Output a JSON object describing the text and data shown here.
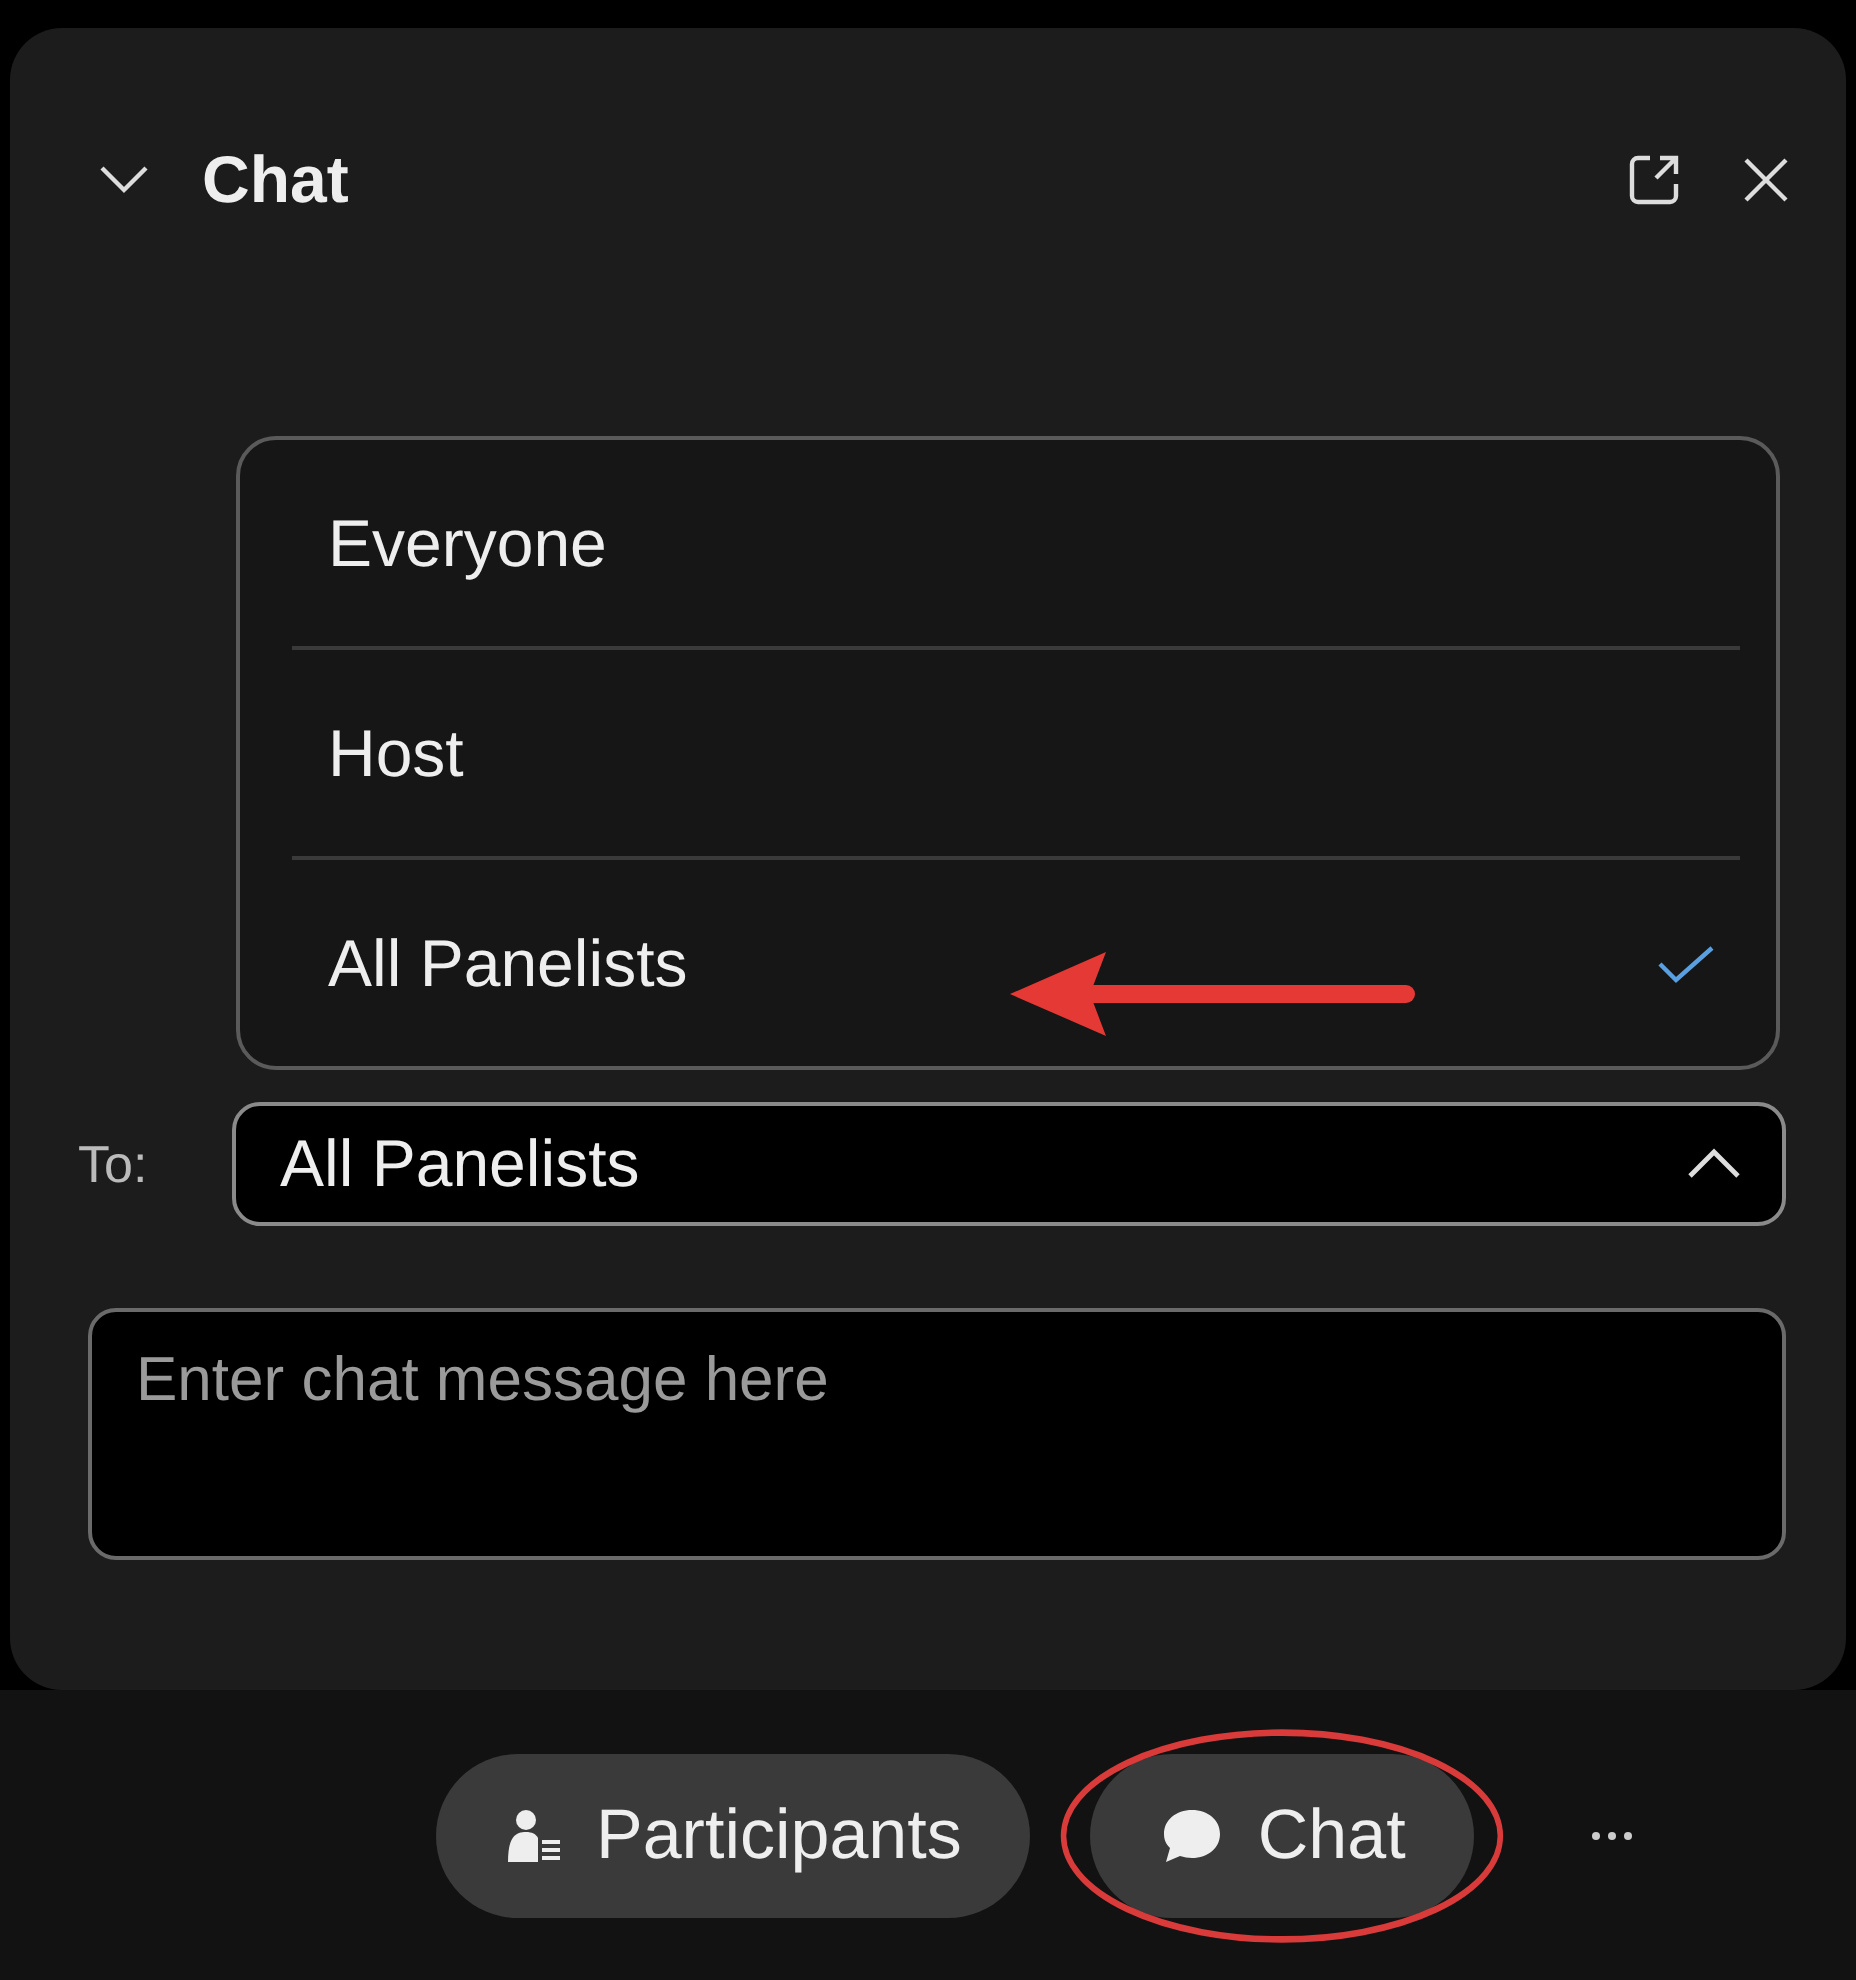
{
  "panel": {
    "title": "Chat"
  },
  "recipient_menu": {
    "items": [
      {
        "label": "Everyone",
        "selected": false
      },
      {
        "label": "Host",
        "selected": false
      },
      {
        "label": "All Panelists",
        "selected": true
      }
    ]
  },
  "to_field": {
    "label": "To:",
    "value": "All Panelists",
    "expanded": true
  },
  "message": {
    "placeholder": "Enter chat message here"
  },
  "toolbar": {
    "buttons": [
      {
        "kind": "participants",
        "label": "Participants",
        "highlighted": false
      },
      {
        "kind": "chat",
        "label": "Chat",
        "highlighted": true
      }
    ]
  }
}
